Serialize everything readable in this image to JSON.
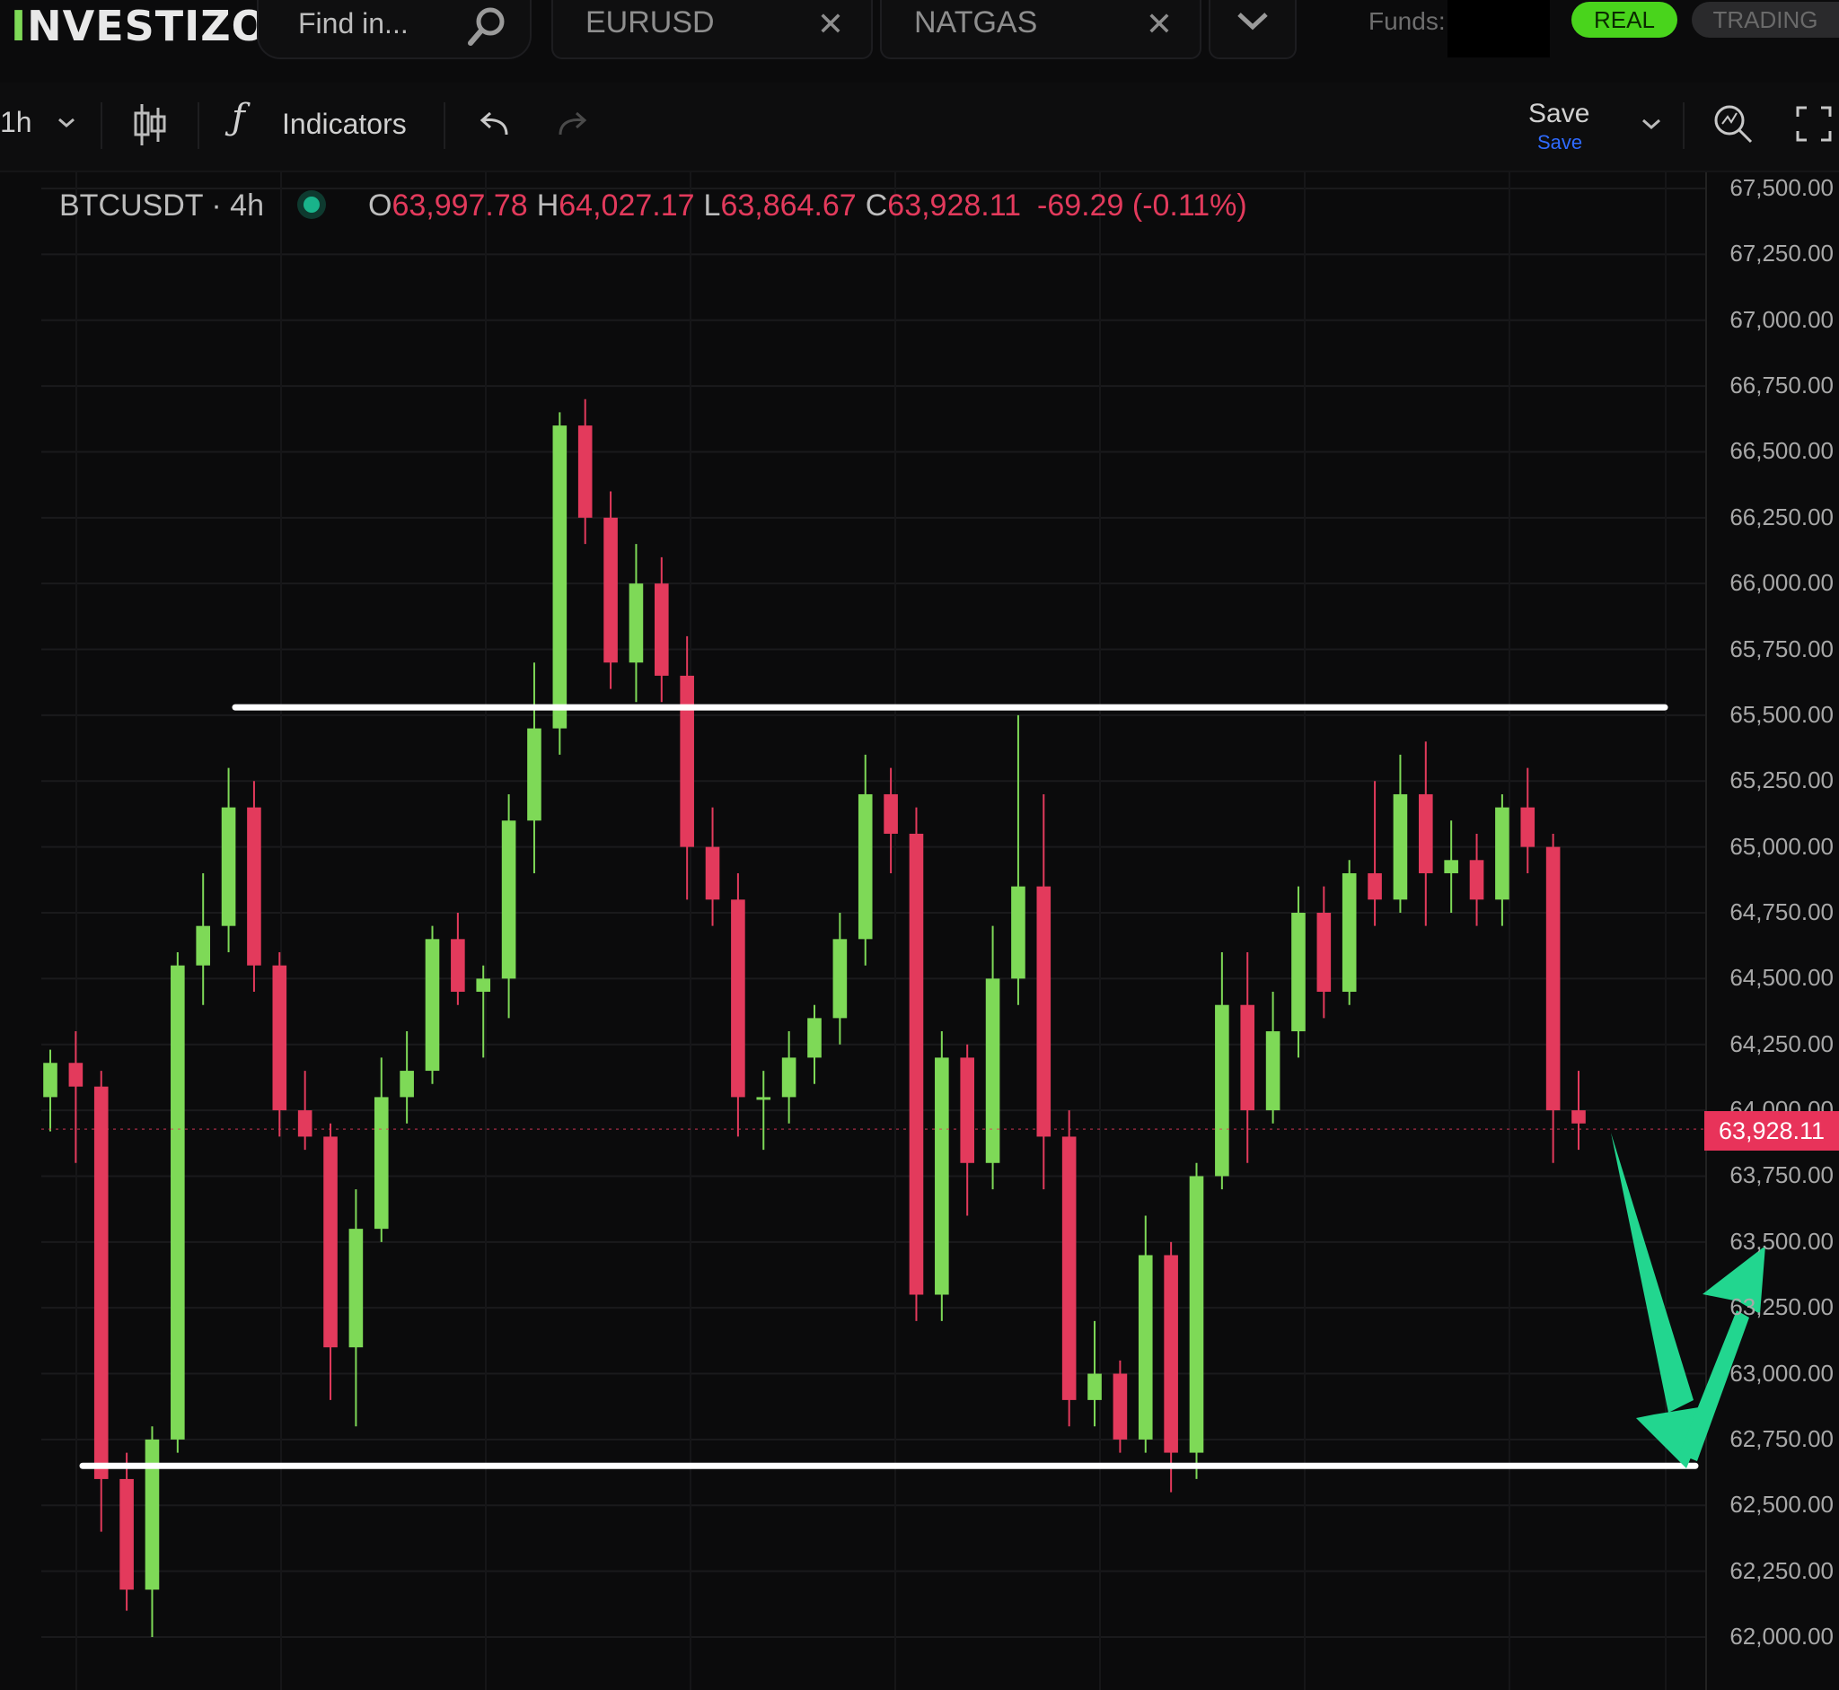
{
  "header": {
    "logo": "INVESTIZO",
    "search_placeholder": "Find in...",
    "tabs": [
      {
        "label": "EURUSD"
      },
      {
        "label": "NATGAS"
      }
    ],
    "funds_label": "Funds:",
    "real_label": "REAL",
    "trading_label": "TRADING"
  },
  "toolbar": {
    "interval": "1h",
    "indicators_label": "Indicators",
    "save_label": "Save",
    "save_sublabel": "Save"
  },
  "legend": {
    "symbol": "BTCUSDT · 4h",
    "o_label": "O",
    "o_value": "63,997.78",
    "h_label": "H",
    "h_value": "64,027.17",
    "l_label": "L",
    "l_value": "63,864.67",
    "c_label": "C",
    "c_value": "63,928.11",
    "change": "-69.29 (-0.11%)"
  },
  "colors": {
    "up": "#7ed957",
    "down": "#e33a5c",
    "accent_green": "#49d41c",
    "arrow": "#22d68f"
  },
  "chart_data": {
    "type": "candlestick",
    "symbol": "BTCUSDT",
    "interval": "4h",
    "ylim": [
      62000,
      67500
    ],
    "yticks": [
      "67,500.00",
      "67,250.00",
      "67,000.00",
      "66,750.00",
      "66,500.00",
      "66,250.00",
      "66,000.00",
      "65,750.00",
      "65,500.00",
      "65,250.00",
      "65,000.00",
      "64,750.00",
      "64,500.00",
      "64,250.00",
      "64,000.00",
      "63,750.00",
      "63,500.00",
      "63,250.00",
      "63,000.00",
      "62,750.00",
      "62,500.00",
      "62,250.00",
      "62,000.00"
    ],
    "last_price": "63,928.11",
    "last_value": 63928.11,
    "horizontal_lines": [
      65530,
      62650
    ],
    "candles": [
      [
        64050,
        64230,
        63920,
        64180
      ],
      [
        64180,
        64300,
        63800,
        64090
      ],
      [
        64090,
        64150,
        62400,
        62600
      ],
      [
        62600,
        62700,
        62100,
        62180
      ],
      [
        62180,
        62800,
        62000,
        62750
      ],
      [
        62750,
        64600,
        62700,
        64550
      ],
      [
        64550,
        64900,
        64400,
        64700
      ],
      [
        64700,
        65300,
        64600,
        65150
      ],
      [
        65150,
        65250,
        64450,
        64550
      ],
      [
        64550,
        64600,
        63900,
        64000
      ],
      [
        64000,
        64150,
        63850,
        63900
      ],
      [
        63900,
        63950,
        62900,
        63100
      ],
      [
        63100,
        63700,
        62800,
        63550
      ],
      [
        63550,
        64200,
        63500,
        64050
      ],
      [
        64050,
        64300,
        63950,
        64150
      ],
      [
        64150,
        64700,
        64100,
        64650
      ],
      [
        64650,
        64750,
        64400,
        64450
      ],
      [
        64450,
        64550,
        64200,
        64500
      ],
      [
        64500,
        65200,
        64350,
        65100
      ],
      [
        65100,
        65700,
        64900,
        65450
      ],
      [
        65450,
        66650,
        65350,
        66600
      ],
      [
        66600,
        66700,
        66150,
        66250
      ],
      [
        66250,
        66350,
        65600,
        65700
      ],
      [
        65700,
        66150,
        65550,
        66000
      ],
      [
        66000,
        66100,
        65550,
        65650
      ],
      [
        65650,
        65800,
        64800,
        65000
      ],
      [
        65000,
        65150,
        64700,
        64800
      ],
      [
        64800,
        64900,
        63900,
        64050
      ],
      [
        64050,
        64150,
        63850,
        64050
      ],
      [
        64050,
        64300,
        63950,
        64200
      ],
      [
        64200,
        64400,
        64100,
        64350
      ],
      [
        64350,
        64750,
        64250,
        64650
      ],
      [
        64650,
        65350,
        64550,
        65200
      ],
      [
        65200,
        65300,
        64900,
        65050
      ],
      [
        65050,
        65150,
        63200,
        63300
      ],
      [
        63300,
        64300,
        63200,
        64200
      ],
      [
        64200,
        64250,
        63600,
        63800
      ],
      [
        63800,
        64700,
        63700,
        64500
      ],
      [
        64500,
        65500,
        64400,
        64850
      ],
      [
        64850,
        65200,
        63700,
        63900
      ],
      [
        63900,
        64000,
        62800,
        62900
      ],
      [
        62900,
        63200,
        62800,
        63000
      ],
      [
        63000,
        63050,
        62700,
        62750
      ],
      [
        62750,
        63600,
        62700,
        63450
      ],
      [
        63450,
        63500,
        62550,
        62700
      ],
      [
        62700,
        63800,
        62600,
        63750
      ],
      [
        63750,
        64600,
        63700,
        64400
      ],
      [
        64400,
        64600,
        63800,
        64000
      ],
      [
        64000,
        64450,
        63950,
        64300
      ],
      [
        64300,
        64850,
        64200,
        64750
      ],
      [
        64750,
        64850,
        64350,
        64450
      ],
      [
        64450,
        64950,
        64400,
        64900
      ],
      [
        64900,
        65250,
        64700,
        64800
      ],
      [
        64800,
        65350,
        64750,
        65200
      ],
      [
        65200,
        65400,
        64700,
        64900
      ],
      [
        64900,
        65100,
        64750,
        64950
      ],
      [
        64950,
        65050,
        64700,
        64800
      ],
      [
        64800,
        65200,
        64700,
        65150
      ],
      [
        65150,
        65300,
        64900,
        65000
      ],
      [
        65000,
        65050,
        63800,
        64000
      ],
      [
        64000,
        64150,
        63850,
        63950
      ]
    ]
  }
}
